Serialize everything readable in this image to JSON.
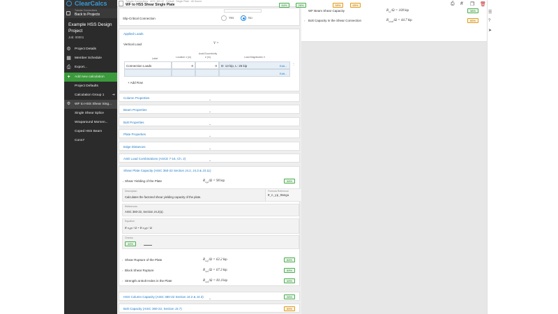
{
  "app": {
    "logo": "ClearCalcs"
  },
  "sidebar": {
    "back_small": "Tubular Connections",
    "back_label": "Back to Projects",
    "project_title": "Example HSS Design Project",
    "job": "Job: 00001",
    "items": [
      {
        "label": "Project Details",
        "icon": "gear-icon"
      },
      {
        "label": "Member Schedule",
        "icon": "grid-icon"
      },
      {
        "label": "Export...",
        "icon": "print-icon"
      },
      {
        "label": "Add new calculation",
        "icon": "plus-icon"
      },
      {
        "label": "Project Defaults"
      },
      {
        "label": "Calculation Group 1"
      },
      {
        "label": "WF to HSS Shear Sing..."
      },
      {
        "label": "Single Shear Splice"
      },
      {
        "label": "Wraparound Momen..."
      },
      {
        "label": "Coped HSS Beam"
      },
      {
        "label": "Conn7"
      }
    ]
  },
  "doc": {
    "crumbs": "Tubular Connections · AISC 360-22 · Default · Single Plate · All Saved",
    "title": "WF to HSS Shear Single Plate"
  },
  "slip": {
    "label": "Slip-Critical Connection",
    "yes": "Yes",
    "no": "No",
    "selected": "No"
  },
  "applied_loads": {
    "title": "Applied Loads",
    "vertical_label": "Vertical Load",
    "vertical_symbol": "V =",
    "headers": {
      "label": "Label",
      "location": "Location x (in)",
      "ecc1": "Axial Eccentricity",
      "ecc2": "e (in)",
      "magnitudes": "Load Magnitudes V"
    },
    "rows": [
      {
        "label": "Connection Loads",
        "location": "0",
        "ecc": "0",
        "magnitudes": "D: 13 kip, L: 25 kip",
        "edit": "Edit..."
      },
      {
        "label": "",
        "location": "",
        "ecc": "",
        "magnitudes": "",
        "edit": "Edit..."
      }
    ],
    "add_row": "Add Row"
  },
  "sections": [
    {
      "title": "Column Properties"
    },
    {
      "title": "Beam Properties"
    },
    {
      "title": "Bolt Properties"
    },
    {
      "title": "Plate Properties"
    },
    {
      "title": "Edge Distances"
    },
    {
      "title": "ASD Load Combinations (ASCE 7-16, Ch. 2)"
    }
  ],
  "shear_plate": {
    "title": "Shear Plate Capacity (AISC 360-22 Section J4.2, J4.3 & J3.11)",
    "yield_label": "Shear Yielding of the Plate",
    "yield_value": "R",
    "yield_sub": "n,yp",
    "yield_eq": "/Ω = 90",
    "yield_unit": "kip",
    "yield_check": "44%",
    "desc_head": "Description",
    "desc_text": "Calculates the factored shear yielding capacity of the plate.",
    "formula_head": "Formula Reference",
    "formula_text": "R_n_yp_Omega",
    "ref_head": "References",
    "ref_text": "AISC 360-22, Section J4.2(a).",
    "eq_head": "Equation",
    "eq_text": "R n,yp / Ω = R n,yp / Ω",
    "checks_head": "Checks",
    "checks_pill": "44%",
    "rows": [
      {
        "label": "Shear Rupture of the Plate",
        "sym": "R",
        "sub": "n,rp",
        "eq": "/Ω = 62.2",
        "unit": "kip",
        "check": "64%"
      },
      {
        "label": "Block Shear Rupture",
        "sym": "R",
        "sub": "n,bs",
        "eq": "/Ω = 67.3",
        "unit": "kip",
        "check": "59%"
      },
      {
        "label": "Strength at Bolt Holes in the Plate",
        "sym": "R",
        "sub": "n,bh",
        "eq": "/Ω = 81.4",
        "unit": "kip",
        "check": "49%"
      }
    ]
  },
  "lower_sections": [
    {
      "title": "HSS Column Capacity (AISC 360-22 Section J4.2 & J4.3)",
      "check": "26%"
    },
    {
      "title": "Bolt Capacity (AISC 360-22, Section J3.7)",
      "check": "59%"
    }
  ],
  "right_panel": {
    "toolbar_pills": [
      "64%",
      "26%",
      "59%",
      "65%"
    ],
    "rows": [
      {
        "label": "WF Beam Shear Capacity",
        "sym": "R",
        "sub": "n,v",
        "eq": "/Ω = 100",
        "unit": "kip",
        "check": "38%"
      },
      {
        "label": "Bolt Capacity in the Shear Connection",
        "sym": "R",
        "sub": "n,bolt",
        "eq": "/Ω = 44.7",
        "unit": "kip",
        "check": "85%"
      }
    ]
  },
  "colors": {
    "accent": "#1e7ac6",
    "green": "#4caf50",
    "orange": "#e09c1f",
    "sidebar": "#2b2b2b",
    "active": "#3b9a3b"
  }
}
